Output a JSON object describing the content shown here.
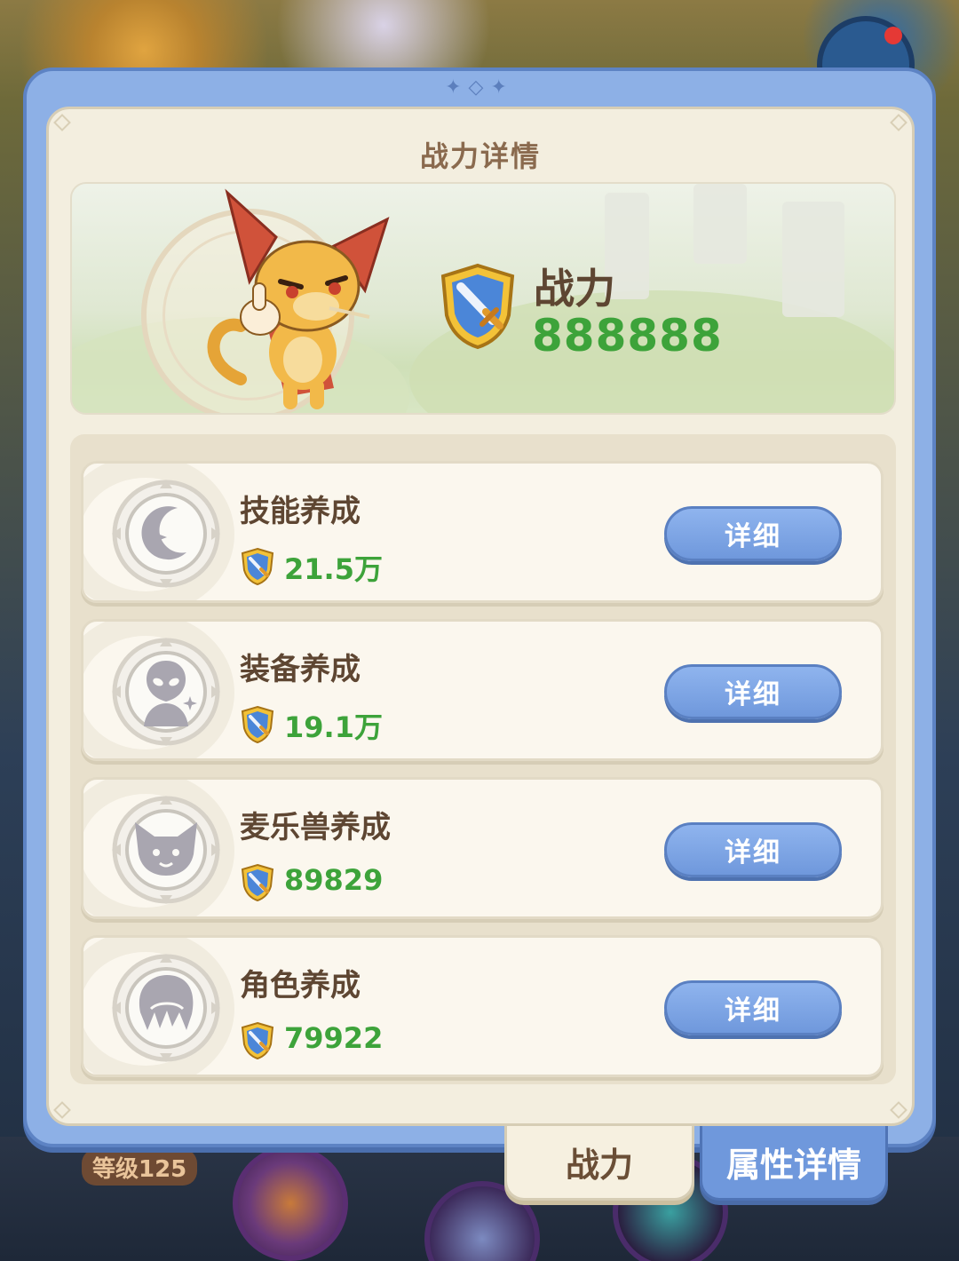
{
  "panel": {
    "title": "战力详情"
  },
  "hero": {
    "power_label": "战力",
    "power_value": "888888"
  },
  "rows": [
    {
      "name": "技能养成",
      "value": "21.5万",
      "button": "详细",
      "icon": "moon-star-icon"
    },
    {
      "name": "装备养成",
      "value": "19.1万",
      "button": "详细",
      "icon": "alien-head-icon"
    },
    {
      "name": "麦乐兽养成",
      "value": "89829",
      "button": "详细",
      "icon": "fox-face-icon"
    },
    {
      "name": "角色养成",
      "value": "79922",
      "button": "详细",
      "icon": "hair-head-icon"
    }
  ],
  "tabs": {
    "power": "战力",
    "attributes": "属性详情"
  },
  "background": {
    "level_chip": "等级125"
  },
  "colors": {
    "accent_blue": "#8db0e6",
    "power_green": "#3da33a",
    "text_brown": "#5e4632"
  }
}
